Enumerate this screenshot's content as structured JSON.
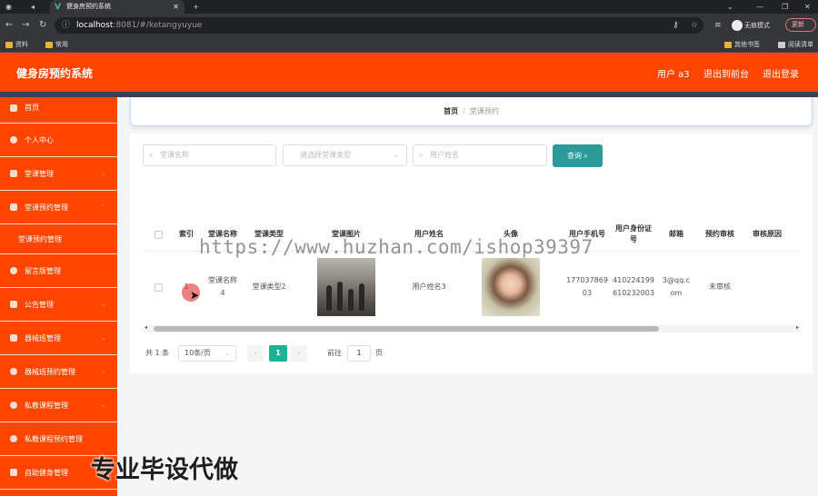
{
  "browser": {
    "tab_title": "健身房预约系统",
    "url_host": "localhost",
    "url_rest": ":8081/#/ketangyuyue",
    "profile_label": "无痕模式",
    "update_label": "更新",
    "bookmarks": [
      "资料",
      "常用"
    ],
    "bookmarks_right": [
      "其他书签",
      "阅读清单"
    ]
  },
  "header": {
    "title": "健身房预约系统",
    "user": "用户 a3",
    "back_front": "退出到前台",
    "logout": "退出登录"
  },
  "sidebar": {
    "items": [
      {
        "label": "首页"
      },
      {
        "label": "个人中心"
      },
      {
        "label": "堂课管理"
      },
      {
        "label": "堂课预约管理"
      },
      {
        "label": "堂课预约管理"
      },
      {
        "label": "留言版管理"
      },
      {
        "label": "公告管理"
      },
      {
        "label": "器械班管理"
      },
      {
        "label": "器械班预约管理"
      },
      {
        "label": "私教课程管理"
      },
      {
        "label": "私教课程预约管理"
      },
      {
        "label": "自助健身管理"
      }
    ]
  },
  "breadcrumb": {
    "home": "首页",
    "current": "堂课预约"
  },
  "search": {
    "name_placeholder": "堂课名称",
    "type_placeholder": "请选择堂课类型",
    "user_placeholder": "用户姓名",
    "query_label": "查询"
  },
  "table": {
    "headers": [
      "索引",
      "堂课名称",
      "堂课类型",
      "堂课图片",
      "用户姓名",
      "头像",
      "用户手机号",
      "用户身份证号",
      "邮箱",
      "预约审核",
      "审核原因"
    ],
    "rows": [
      {
        "index": "1",
        "name": "堂课名称4",
        "type": "堂课类型2",
        "image": "gym-class-photo",
        "user": "用户姓名3",
        "avatar": "user-avatar-photo",
        "phone": "17703786903",
        "id_card": "410224199610232003",
        "email": "3@qq.com",
        "review": "未审核",
        "reason": ""
      }
    ]
  },
  "pagination": {
    "total": "共 1 条",
    "page_size": "10条/页",
    "current_page": "1",
    "goto_label": "前往",
    "goto_value": "1",
    "page_suffix": "页"
  },
  "overlays": {
    "watermark": "https://www.huzhan.com/ishop39397",
    "promo": "专业毕设代做"
  },
  "colors": {
    "primary": "#ff4500",
    "teal": "#2b9a98",
    "pager_active": "#1ab394"
  }
}
